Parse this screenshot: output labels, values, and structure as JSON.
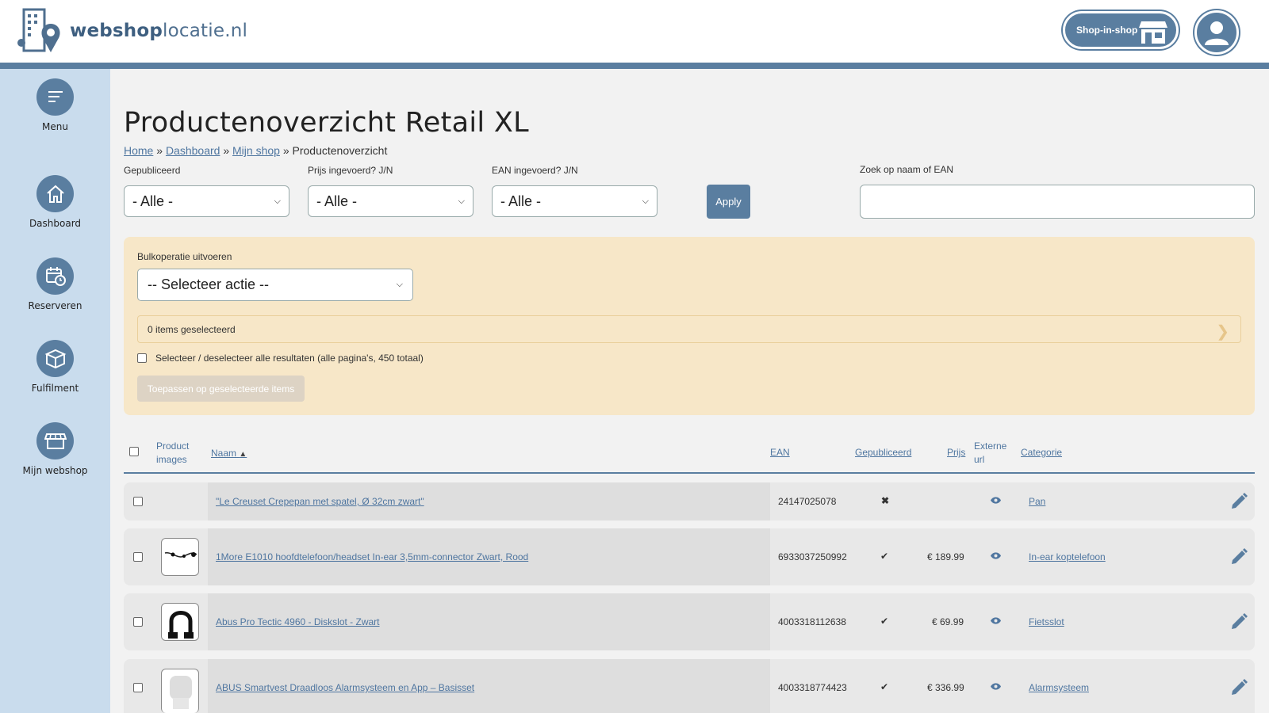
{
  "header": {
    "logo_text_bold": "webshop",
    "logo_text_rest": "locatie.nl",
    "shop_in_shop_label": "Shop-in-shop"
  },
  "sidebar": {
    "items": [
      {
        "label": "Menu",
        "icon": "menu-icon"
      },
      {
        "label": "Dashboard",
        "icon": "home-icon"
      },
      {
        "label": "Reserveren",
        "icon": "calendar-clock-icon"
      },
      {
        "label": "Fulfilment",
        "icon": "box-icon"
      },
      {
        "label": "Mijn webshop",
        "icon": "store-icon"
      }
    ]
  },
  "page": {
    "title": "Productenoverzicht Retail XL",
    "breadcrumb": {
      "home": "Home",
      "sep": "»",
      "dashboard": "Dashboard",
      "shop": "Mijn shop",
      "current": "Productenoverzicht"
    }
  },
  "filters": {
    "published_label": "Gepubliceerd",
    "published_value": "- Alle -",
    "price_label": "Prijs ingevoerd? J/N",
    "price_value": "- Alle -",
    "ean_label": "EAN ingevoerd? J/N",
    "ean_value": "- Alle -",
    "apply_label": "Apply",
    "search_label": "Zoek op naam of EAN",
    "search_value": ""
  },
  "bulk": {
    "label": "Bulkoperatie uitvoeren",
    "select_value": "-- Selecteer actie --",
    "selected_text": "0 items geselecteerd",
    "select_all_text": "Selecteer / deselecteer alle resultaten (alle pagina's, 450 totaal)",
    "apply_selected_label": "Toepassen op geselecteerde items"
  },
  "table": {
    "headers": {
      "images_line1": "Product",
      "images_line2": "images",
      "name": "Naam",
      "ean": "EAN",
      "published": "Gepubliceerd",
      "price": "Prijs",
      "external_line1": "Externe",
      "external_line2": "url",
      "category": "Categorie"
    },
    "rows": [
      {
        "name": "\"Le Creuset Crepepan met spatel, Ø 32cm zwart\"",
        "ean": "24147025078",
        "published": "✖",
        "price": "",
        "category": "Pan"
      },
      {
        "name": "1More E1010 hoofdtelefoon/headset In-ear 3,5mm-connector Zwart, Rood",
        "ean": "6933037250992",
        "published": "✔",
        "price": "€ 189.99",
        "category": "In-ear koptelefoon"
      },
      {
        "name": "Abus Pro Tectic 4960 - Diskslot - Zwart",
        "ean": "4003318112638",
        "published": "✔",
        "price": "€ 69.99",
        "category": "Fietsslot"
      },
      {
        "name": "ABUS Smartvest Draadloos Alarmsysteem en App – Basisset",
        "ean": "4003318774423",
        "published": "✔",
        "price": "€ 336.99",
        "category": "Alarmsysteem"
      }
    ]
  },
  "colors": {
    "accent": "#5a7ea0",
    "sidebar": "#c9dced",
    "bulk_bg": "#f7e7c8",
    "link": "#4f76a0"
  }
}
